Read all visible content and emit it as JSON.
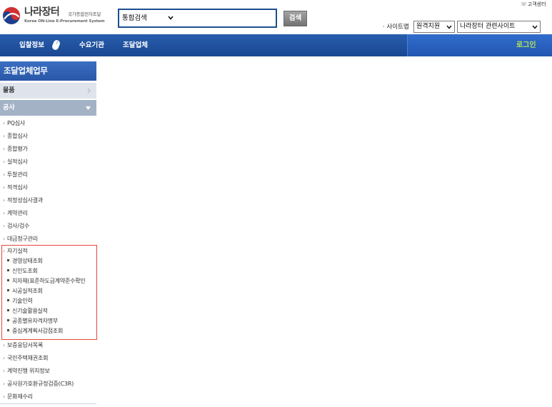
{
  "header": {
    "logo": {
      "icon": "nara-logo-icon",
      "title": "나라장터",
      "subtitle_ko": "국가종합전자조달",
      "subtitle_en": "Korea ON-Line E-Procurement System"
    },
    "search": {
      "scope_selected": "통합검색",
      "button_label": "검색"
    },
    "customer_center": {
      "icon": "phone-icon",
      "label": "고객센터"
    },
    "sitemap_label": "· 사이트맵",
    "remote_support": {
      "selected": "원격지원"
    },
    "related_sites": {
      "selected": "나라장터 관련사이트"
    }
  },
  "nav": {
    "items": [
      {
        "label": "입찰정보",
        "icon": "mouse-icon"
      },
      {
        "label": "수요기관"
      },
      {
        "label": "조달업체"
      }
    ],
    "login_label": "로그인"
  },
  "sidebar": {
    "title": "조달업체업무",
    "categories": [
      {
        "label": "물품",
        "icon": "chevron-right-icon"
      },
      {
        "label": "공사",
        "icon": "triangle-down-icon"
      }
    ],
    "menu": [
      {
        "label": "PQ심사"
      },
      {
        "label": "종합심사"
      },
      {
        "label": "종합평가"
      },
      {
        "label": "실적심사"
      },
      {
        "label": "투찰관리"
      },
      {
        "label": "적격심사"
      },
      {
        "label": "적정성심사결과"
      },
      {
        "label": "계약관리"
      },
      {
        "label": "검사/검수"
      },
      {
        "label": "대금청구관리"
      },
      {
        "label": "자기실적",
        "children": [
          "경영상태조회",
          "신인도조회",
          "지자체(표준하도급계약준수확인",
          "시공실적조회",
          "기술인력",
          "신기술활용실적",
          "공종별유자격자명부",
          "중심계계획서감점조회"
        ]
      },
      {
        "label": "보증응답서목록"
      },
      {
        "label": "국민주택채권조회"
      },
      {
        "label": "계약진행 위치정보"
      },
      {
        "label": "공사원가호환규정검증(C3R)"
      },
      {
        "label": "문화재수리"
      }
    ]
  },
  "colors": {
    "nav_bg": "#1a4791",
    "nav_right_bg": "#2356b1",
    "login_text": "#b3e45a",
    "search_border": "#1c4f8f",
    "sidebar_title_bg": "#2a57a7",
    "category_inactive_bg": "#dfe4ec",
    "category_active_bg": "#a4b2c6",
    "highlight_border": "#e4473d"
  }
}
